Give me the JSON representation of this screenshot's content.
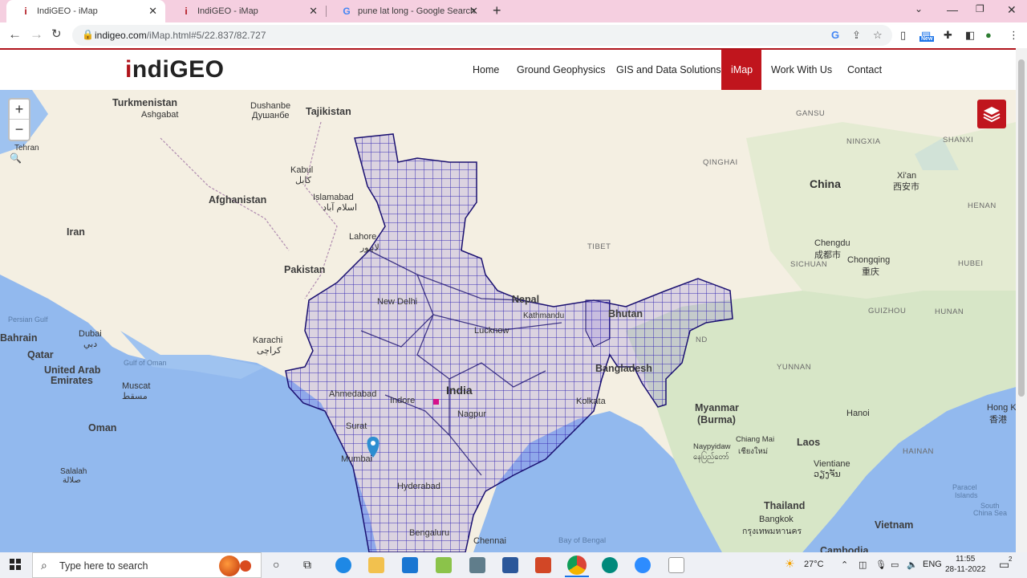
{
  "browser": {
    "tabs": [
      {
        "title": "IndiGEO - iMap",
        "favicon": "i"
      },
      {
        "title": "IndiGEO - iMap",
        "favicon": "i"
      },
      {
        "title": "pune lat long - Google Search",
        "favicon": "G"
      }
    ],
    "url_host": "indigeo.com",
    "url_path": "/iMap.html#5/22.837/82.727"
  },
  "site": {
    "logo_i": "i",
    "logo_rest": "ndiGEO",
    "nav": [
      "Home",
      "Ground Geophysics",
      "GIS and Data Solutions",
      "iMap",
      "Work With Us",
      "Contact"
    ],
    "active_nav": "iMap",
    "accent": "#c0151d"
  },
  "map": {
    "zoom_in": "+",
    "zoom_out": "−",
    "labels": {
      "turkmenistan": "Turkmenistan",
      "ashgabat": "Ashgabat",
      "dushanbe": "Dushanbe",
      "dushanbe_local": "Душанбе",
      "tajikistan": "Tajikistan",
      "tehran": "Tehran",
      "afghanistan": "Afghanistan",
      "kabul": "Kabul",
      "kabul_local": "کابل",
      "islamabad": "Islamabad",
      "islamabad_local": "اسلام آباد",
      "iran": "Iran",
      "lahore": "Lahore",
      "lahore_local": "لاہور",
      "pakistan": "Pakistan",
      "karachi": "Karachi",
      "karachi_local": "کراچی",
      "persian_gulf": "Persian Gulf",
      "bahrain": "Bahrain",
      "qatar": "Qatar",
      "dubai": "Dubai",
      "dubai_local": "دبي",
      "uae1": "United Arab",
      "uae2": "Emirates",
      "gulf_oman": "Gulf of Oman",
      "muscat": "Muscat",
      "muscat_local": "مسقط",
      "oman": "Oman",
      "salalah": "Salalah",
      "salalah_local": "صلالة",
      "new_delhi": "New Delhi",
      "lucknow": "Lucknow",
      "nepal": "Nepal",
      "kathmandu": "Kathmandu",
      "bhutan": "Bhutan",
      "india": "India",
      "ahmedabad": "Ahmedabad",
      "indore": "Indore",
      "surat": "Surat",
      "nagpur": "Nagpur",
      "mumbai": "Mumbai",
      "hyderabad": "Hyderabad",
      "bengaluru": "Bengaluru",
      "chennai": "Chennai",
      "kolkata": "Kolkata",
      "bangladesh": "Bangladesh",
      "bay_bengal": "Bay of Bengal",
      "tibet": "TIBET",
      "qinghai": "QINGHAI",
      "gansu": "GANSU",
      "ningxia": "NINGXIA",
      "shanxi": "SHANXI",
      "china": "China",
      "xian": "Xi'an",
      "xian_local": "西安市",
      "henan": "HENAN",
      "chengdu": "Chengdu",
      "chengdu_local": "成都市",
      "sichuan": "SICHUAN",
      "chongqing": "Chongqing",
      "chongqing_local": "重庆",
      "hubei": "HUBEI",
      "guizhou": "GUIZHOU",
      "hunan": "HUNAN",
      "yunnan": "YUNNAN",
      "myanmar1": "Myanmar",
      "myanmar2": "(Burma)",
      "naypyidaw": "Naypyidaw",
      "naypyidaw_local": "နေပြည်တော်",
      "chiang_mai": "Chiang Mai",
      "chiang_mai_local": "เชียงใหม่",
      "laos": "Laos",
      "hanoi": "Hanoi",
      "hong_kong": "Hong K",
      "hong_kong_local": "香港",
      "vientiane": "Vientiane",
      "vientiane_local": "ວຽງຈັນ",
      "hainan": "HAINAN",
      "paracel1": "Paracel",
      "paracel2": "Islands",
      "south_china_sea1": "South",
      "south_china_sea2": "China Sea",
      "thailand": "Thailand",
      "bangkok": "Bangkok",
      "bangkok_local": "กรุงเทพมหานคร",
      "vietnam": "Vietnam",
      "cambodia": "Cambodia",
      "nd_partial": "ND"
    }
  },
  "taskbar": {
    "search_placeholder": "Type here to search",
    "temperature": "27°C",
    "language": "ENG",
    "time": "11:55",
    "date": "28-11-2022",
    "notifications": "2"
  }
}
